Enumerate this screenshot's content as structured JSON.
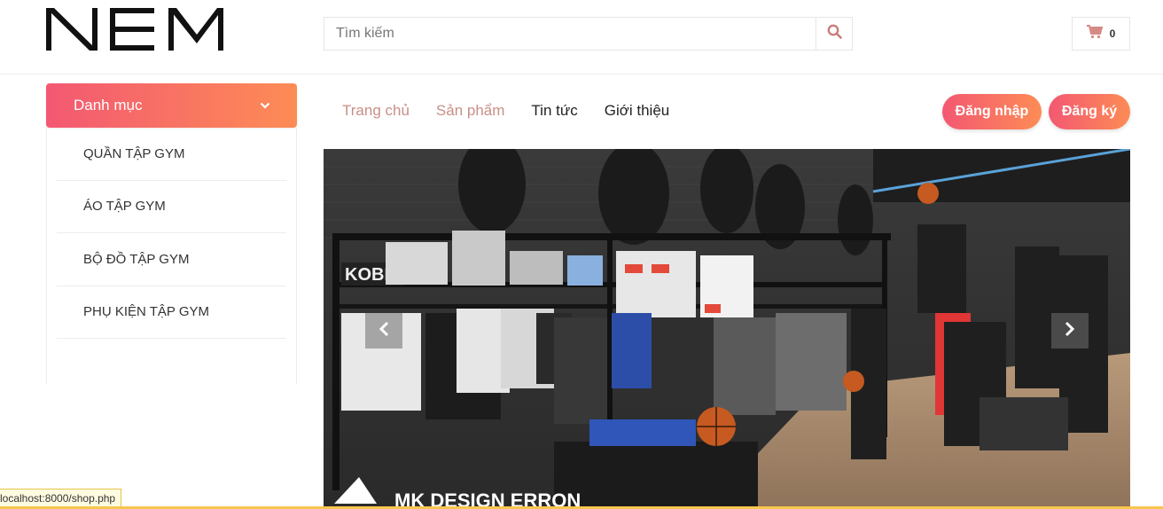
{
  "header": {
    "logo_text": "NEM",
    "search": {
      "placeholder": "Tìm kiếm",
      "icon": "search-icon"
    },
    "cart": {
      "icon": "cart-icon",
      "count": "0"
    }
  },
  "sidebar": {
    "title": "Danh mục",
    "toggle_icon": "chevron-down-icon",
    "items": [
      {
        "label": "QUẦN TẬP GYM"
      },
      {
        "label": "ÁO TẬP GYM"
      },
      {
        "label": "BỘ ĐỒ TẬP GYM"
      },
      {
        "label": "PHỤ KIỆN TẬP GYM"
      }
    ]
  },
  "nav": {
    "items": [
      {
        "label": "Trang chủ"
      },
      {
        "label": "Sản phẩm"
      },
      {
        "label": "Tin tức"
      },
      {
        "label": "Giới thiệu"
      }
    ]
  },
  "auth": {
    "login_label": "Đăng nhập",
    "register_label": "Đăng ký"
  },
  "banner": {
    "wall_sign": "KOBE",
    "watermark": "MK DESIGN ERRON",
    "prev_icon": "chevron-left-icon",
    "next_icon": "chevron-right-icon"
  },
  "statusbar": {
    "url": "localhost:8000/shop.php"
  },
  "colors": {
    "accent_start": "#f35872",
    "accent_end": "#fd8c55",
    "nav_faded": "#c98f87"
  }
}
